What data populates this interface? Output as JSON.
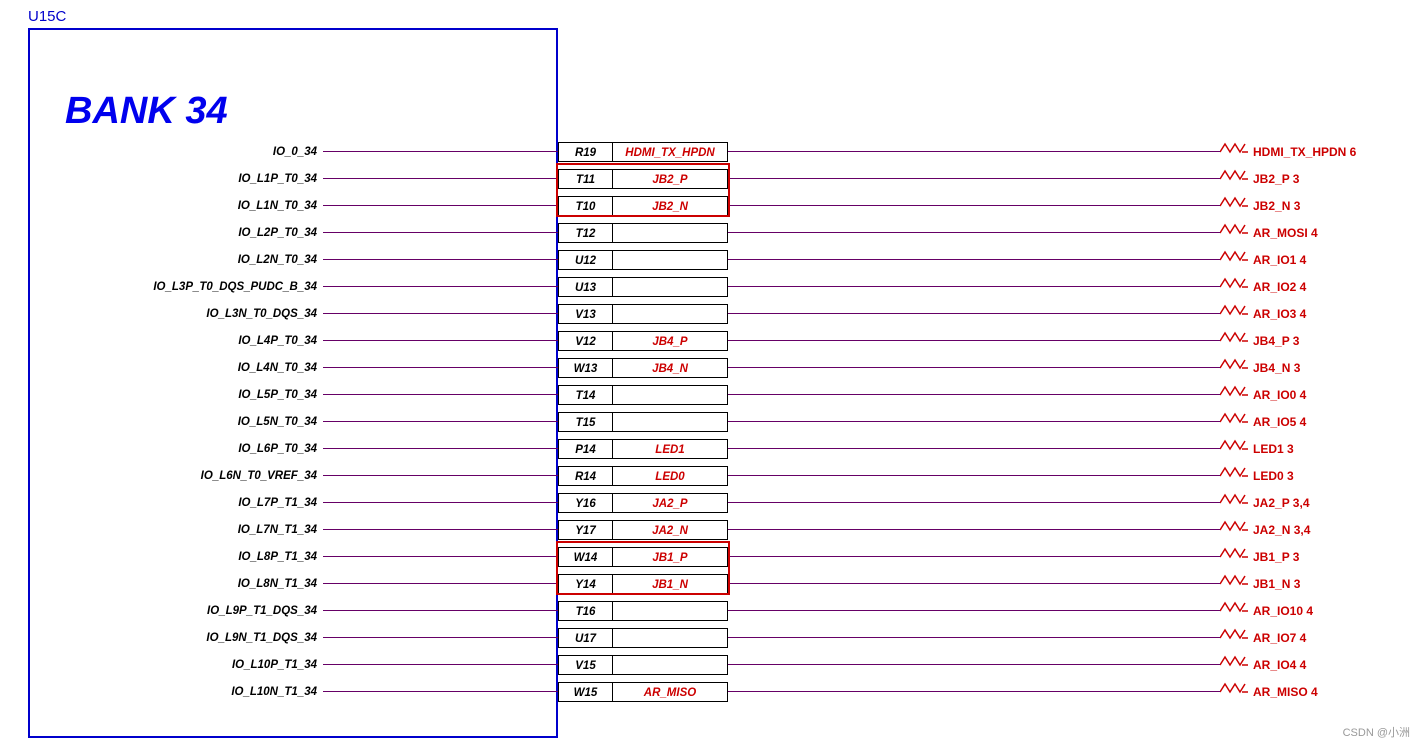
{
  "title": "U15C",
  "bank": "BANK 34",
  "accent_color": "#0000cc",
  "net_color": "#cc0000",
  "line_color": "#660066",
  "pins": [
    {
      "name": "IO_0_34",
      "pad": "R19",
      "net": "HDMI_TX_HPDN",
      "right_net": "HDMI_TX_HPDN",
      "right_num": "6",
      "has_net": true,
      "highlight": false
    },
    {
      "name": "IO_L1P_T0_34",
      "pad": "T11",
      "net": "JB2_P",
      "right_net": "JB2_P",
      "right_num": "3",
      "has_net": true,
      "highlight": true
    },
    {
      "name": "IO_L1N_T0_34",
      "pad": "T10",
      "net": "JB2_N",
      "right_net": "JB2_N",
      "right_num": "3",
      "has_net": true,
      "highlight": true
    },
    {
      "name": "IO_L2P_T0_34",
      "pad": "T12",
      "net": "",
      "right_net": "AR_MOSI",
      "right_num": "4",
      "has_net": false,
      "highlight": false
    },
    {
      "name": "IO_L2N_T0_34",
      "pad": "U12",
      "net": "",
      "right_net": "AR_IO1",
      "right_num": "4",
      "has_net": false,
      "highlight": false
    },
    {
      "name": "IO_L3P_T0_DQS_PUDC_B_34",
      "pad": "U13",
      "net": "",
      "right_net": "AR_IO2",
      "right_num": "4",
      "has_net": false,
      "highlight": false
    },
    {
      "name": "IO_L3N_T0_DQS_34",
      "pad": "V13",
      "net": "",
      "right_net": "AR_IO3",
      "right_num": "4",
      "has_net": false,
      "highlight": false
    },
    {
      "name": "IO_L4P_T0_34",
      "pad": "V12",
      "net": "JB4_P",
      "right_net": "JB4_P",
      "right_num": "3",
      "has_net": true,
      "highlight": false
    },
    {
      "name": "IO_L4N_T0_34",
      "pad": "W13",
      "net": "JB4_N",
      "right_net": "JB4_N",
      "right_num": "3",
      "has_net": true,
      "highlight": false
    },
    {
      "name": "IO_L5P_T0_34",
      "pad": "T14",
      "net": "",
      "right_net": "AR_IO0",
      "right_num": "4",
      "has_net": false,
      "highlight": false
    },
    {
      "name": "IO_L5N_T0_34",
      "pad": "T15",
      "net": "",
      "right_net": "AR_IO5",
      "right_num": "4",
      "has_net": false,
      "highlight": false
    },
    {
      "name": "IO_L6P_T0_34",
      "pad": "P14",
      "net": "LED1",
      "right_net": "LED1",
      "right_num": "3",
      "has_net": true,
      "highlight": false
    },
    {
      "name": "IO_L6N_T0_VREF_34",
      "pad": "R14",
      "net": "LED0",
      "right_net": "LED0",
      "right_num": "3",
      "has_net": true,
      "highlight": false
    },
    {
      "name": "IO_L7P_T1_34",
      "pad": "Y16",
      "net": "JA2_P",
      "right_net": "JA2_P",
      "right_num": "3,4",
      "has_net": true,
      "highlight": false
    },
    {
      "name": "IO_L7N_T1_34",
      "pad": "Y17",
      "net": "JA2_N",
      "right_net": "JA2_N",
      "right_num": "3,4",
      "has_net": true,
      "highlight": false
    },
    {
      "name": "IO_L8P_T1_34",
      "pad": "W14",
      "net": "JB1_P",
      "right_net": "JB1_P",
      "right_num": "3",
      "has_net": true,
      "highlight": true
    },
    {
      "name": "IO_L8N_T1_34",
      "pad": "Y14",
      "net": "JB1_N",
      "right_net": "JB1_N",
      "right_num": "3",
      "has_net": true,
      "highlight": true
    },
    {
      "name": "IO_L9P_T1_DQS_34",
      "pad": "T16",
      "net": "",
      "right_net": "AR_IO10",
      "right_num": "4",
      "has_net": false,
      "highlight": false
    },
    {
      "name": "IO_L9N_T1_DQS_34",
      "pad": "U17",
      "net": "",
      "right_net": "AR_IO7",
      "right_num": "4",
      "has_net": false,
      "highlight": false
    },
    {
      "name": "IO_L10P_T1_34",
      "pad": "V15",
      "net": "",
      "right_net": "AR_IO4",
      "right_num": "4",
      "has_net": false,
      "highlight": false
    },
    {
      "name": "IO_L10N_T1_34",
      "pad": "W15",
      "net": "AR_MISO",
      "right_net": "AR_MISO",
      "right_num": "4",
      "has_net": true,
      "highlight": false
    }
  ],
  "watermark": "CSDN @小洲"
}
